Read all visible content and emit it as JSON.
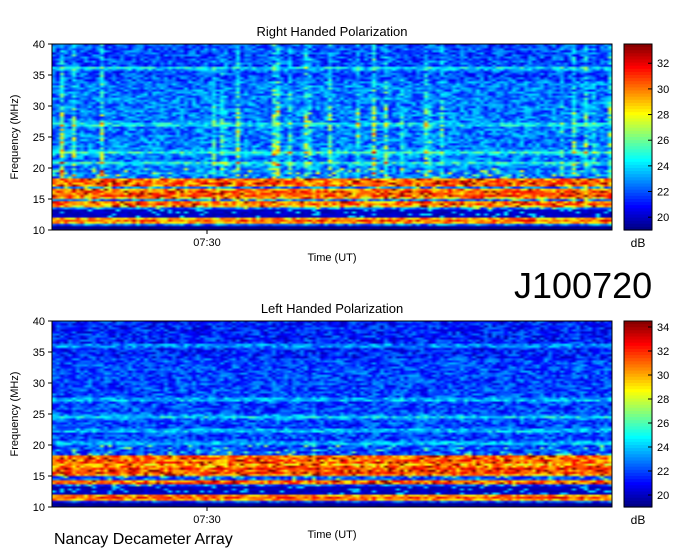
{
  "observation_id": "J100720",
  "instrument": "Nancay Decameter Array",
  "chart_data": [
    {
      "type": "heatmap",
      "title": "Right Handed Polarization",
      "xlabel": "Time (UT)",
      "ylabel": "Frequency (MHz)",
      "xticks": [
        "07:30"
      ],
      "yticks": [
        10,
        15,
        20,
        25,
        30,
        35,
        40
      ],
      "ylim": [
        10,
        40
      ],
      "colorbar": {
        "label": "dB",
        "ticks": [
          20,
          22,
          24,
          26,
          28,
          30,
          32
        ],
        "range": [
          19,
          33.5
        ]
      },
      "features": {
        "strong_bands_mhz": [
          11.5,
          14.3,
          15.6,
          16.2,
          17.4,
          18.0
        ],
        "minor_bands_mhz": [
          20.8,
          22.5,
          27.0,
          36.1
        ],
        "background_db": 22.5
      }
    },
    {
      "type": "heatmap",
      "title": "Left Handed Polarization",
      "xlabel": "Time (UT)",
      "ylabel": "Frequency (MHz)",
      "xticks": [
        "07:30"
      ],
      "yticks": [
        10,
        15,
        20,
        25,
        30,
        35,
        40
      ],
      "ylim": [
        10,
        40
      ],
      "colorbar": {
        "label": "dB",
        "ticks": [
          20,
          22,
          24,
          26,
          28,
          30,
          32,
          34
        ],
        "range": [
          19,
          34.5
        ]
      },
      "features": {
        "strong_bands_mhz": [
          11.5,
          14.0,
          15.5,
          16.2,
          17.3,
          18.0
        ],
        "minor_bands_mhz": [
          20.3,
          22.3,
          24.5,
          27.3,
          36.0
        ],
        "background_db": 22.0
      }
    }
  ]
}
